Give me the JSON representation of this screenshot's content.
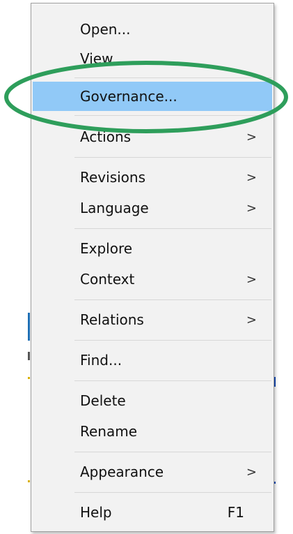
{
  "menu": {
    "items": [
      {
        "label": "Open...",
        "arrow": "",
        "shortcut": ""
      },
      {
        "label": "View...",
        "arrow": "",
        "shortcut": ""
      },
      {
        "label": "Governance...",
        "arrow": "",
        "shortcut": ""
      },
      {
        "label": "Actions",
        "arrow": ">",
        "shortcut": ""
      },
      {
        "label": "Revisions",
        "arrow": ">",
        "shortcut": ""
      },
      {
        "label": "Language",
        "arrow": ">",
        "shortcut": ""
      },
      {
        "label": "Explore",
        "arrow": "",
        "shortcut": ""
      },
      {
        "label": "Context",
        "arrow": ">",
        "shortcut": ""
      },
      {
        "label": "Relations",
        "arrow": ">",
        "shortcut": ""
      },
      {
        "label": "Find...",
        "arrow": "",
        "shortcut": ""
      },
      {
        "label": "Delete",
        "arrow": "",
        "shortcut": ""
      },
      {
        "label": "Rename",
        "arrow": "",
        "shortcut": ""
      },
      {
        "label": "Appearance",
        "arrow": ">",
        "shortcut": ""
      },
      {
        "label": "Help",
        "arrow": "",
        "shortcut": "F1"
      }
    ],
    "highlighted_item": "Governance..."
  },
  "colors": {
    "highlight": "#91c9f7",
    "annotation_ellipse": "#2e9e5b",
    "menu_background": "#f2f2f2"
  }
}
